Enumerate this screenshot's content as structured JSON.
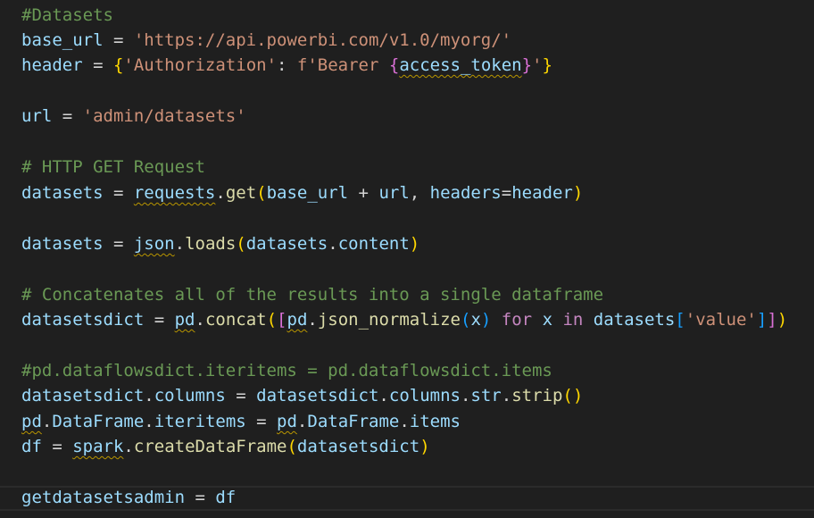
{
  "code": {
    "l1": {
      "comment": "#Datasets"
    },
    "l2": {
      "var": "base_url",
      "eq": " = ",
      "str": "'https://api.powerbi.com/v1.0/myorg/'"
    },
    "l3": {
      "var": "header",
      "eq": " = ",
      "b_open": "{",
      "key": "'Authorization'",
      "colon": ": ",
      "f": "f'Bearer ",
      "inner_open": "{",
      "token": "access_token",
      "inner_close": "}",
      "q": "'",
      "b_close": "}"
    },
    "l5": {
      "var": "url",
      "eq": " = ",
      "str": "'admin/datasets'"
    },
    "l7": {
      "comment": "# HTTP GET Request"
    },
    "l8": {
      "var": "datasets",
      "eq": " = ",
      "mod": "requests",
      "dot": ".",
      "fn": "get",
      "p_open": "(",
      "a1": "base_url",
      "plus": " + ",
      "a2": "url",
      "comma": ", ",
      "kw": "headers",
      "assign": "=",
      "a3": "header",
      "p_close": ")"
    },
    "l10": {
      "var": "datasets",
      "eq": " = ",
      "mod": "json",
      "dot": ".",
      "fn": "loads",
      "p_open": "(",
      "a1": "datasets",
      "dot2": ".",
      "a2": "content",
      "p_close": ")"
    },
    "l12": {
      "comment": "# Concatenates all of the results into a single dataframe"
    },
    "l13": {
      "var": "datasetsdict",
      "eq": " = ",
      "mod": "pd",
      "dot": ".",
      "fn": "concat",
      "p_open": "(",
      "br_open": "[",
      "mod2": "pd",
      "dot2": ".",
      "fn2": "json_normalize",
      "p2_open": "(",
      "x": "x",
      "p2_close": ")",
      "for": " for ",
      "x2": "x",
      "in": " in ",
      "ds": "datasets",
      "br2_open": "[",
      "val": "'value'",
      "br2_close": "]",
      "br_close": "]",
      "p_close": ")"
    },
    "l15": {
      "comment": "#pd.dataflowsdict.iteritems = pd.dataflowsdict.items"
    },
    "l16": {
      "var": "datasetsdict",
      "dot": ".",
      "attr": "columns",
      "eq": " = ",
      "var2": "datasetsdict",
      "dot2": ".",
      "attr2": "columns",
      "dot3": ".",
      "attr3": "str",
      "dot4": ".",
      "fn": "strip",
      "parens": "()"
    },
    "l17": {
      "mod": "pd",
      "dot": ".",
      "cls": "DataFrame",
      "dot2": ".",
      "attr": "iteritems",
      "eq": " = ",
      "mod2": "pd",
      "dot3": ".",
      "cls2": "DataFrame",
      "dot4": ".",
      "attr2": "items"
    },
    "l18": {
      "var": "df",
      "eq": " = ",
      "mod": "spark",
      "dot": ".",
      "fn": "createDataFrame",
      "p_open": "(",
      "arg": "datasetsdict",
      "p_close": ")"
    },
    "l20": {
      "var": "getdatasetsadmin",
      "eq": " = ",
      "var2": "df"
    }
  },
  "colors": {
    "background": "#1f1f1f",
    "comment": "#6a9955",
    "variable": "#9cdcfe",
    "string": "#ce9178",
    "function": "#dcdcaa",
    "keyword": "#c586c0",
    "bracket_level1": "#ffd700",
    "bracket_level2": "#da70d6",
    "bracket_level3": "#179fff",
    "squiggle": "#b89500"
  }
}
